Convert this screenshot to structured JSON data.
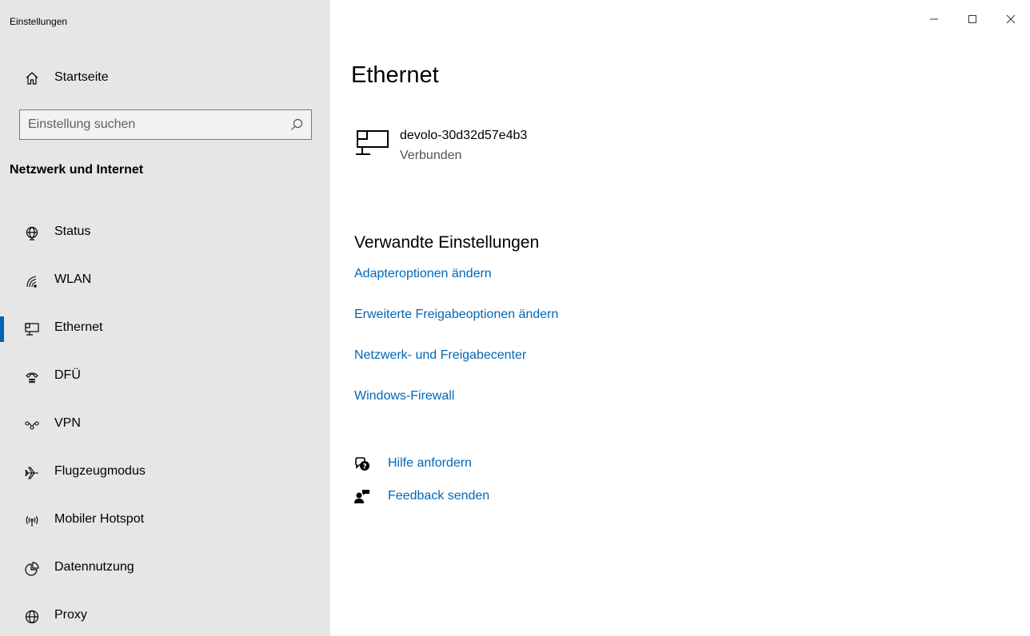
{
  "window": {
    "app_title": "Einstellungen",
    "controls": [
      "minimize-icon",
      "maximize-icon",
      "close-icon"
    ]
  },
  "sidebar": {
    "home_label": "Startseite",
    "search": {
      "placeholder": "Einstellung suchen",
      "value": ""
    },
    "section_heading": "Netzwerk und Internet",
    "active_item": "Ethernet",
    "items": [
      {
        "label": "Status",
        "icon": "globe-status-icon"
      },
      {
        "label": "WLAN",
        "icon": "wifi-icon"
      },
      {
        "label": "Ethernet",
        "icon": "ethernet-icon"
      },
      {
        "label": "DFÜ",
        "icon": "dialup-icon"
      },
      {
        "label": "VPN",
        "icon": "vpn-icon"
      },
      {
        "label": "Flugzeugmodus",
        "icon": "airplane-icon"
      },
      {
        "label": "Mobiler Hotspot",
        "icon": "hotspot-icon"
      },
      {
        "label": "Datennutzung",
        "icon": "data-usage-icon"
      },
      {
        "label": "Proxy",
        "icon": "globe-icon"
      }
    ]
  },
  "main": {
    "title": "Ethernet",
    "network": {
      "name": "devolo-30d32d57e4b3",
      "status": "Verbunden",
      "icon": "ethernet-icon"
    },
    "related_heading": "Verwandte Einstellungen",
    "related_links": [
      "Adapteroptionen ändern",
      "Erweiterte Freigabeoptionen ändern",
      "Netzwerk- und Freigabecenter",
      "Windows-Firewall"
    ],
    "help": {
      "get_help": "Hilfe anfordern",
      "feedback": "Feedback senden"
    }
  },
  "colors": {
    "sidebar_bg": "#e6e6e6",
    "accent": "#0063b1",
    "link": "#0067b8"
  }
}
